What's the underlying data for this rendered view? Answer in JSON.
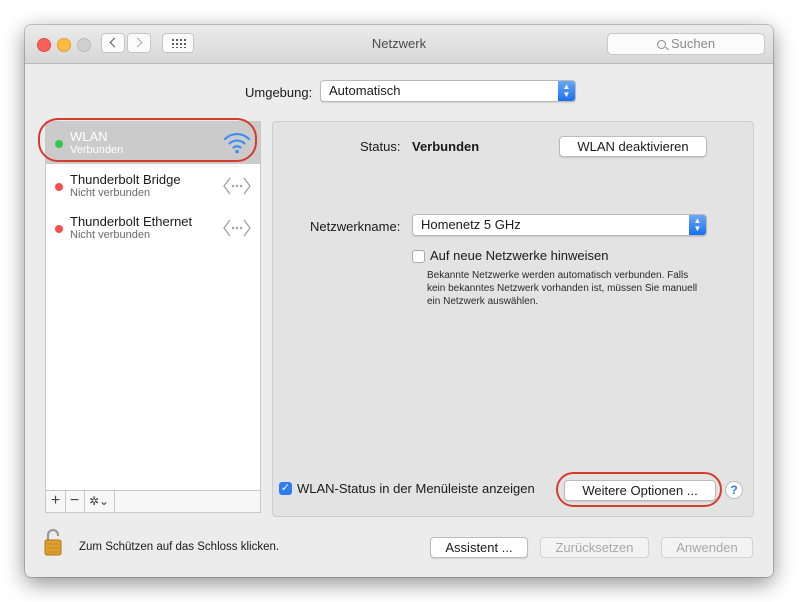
{
  "window": {
    "title": "Netzwerk"
  },
  "toolbar": {
    "search_placeholder": "Suchen"
  },
  "location": {
    "label": "Umgebung:",
    "value": "Automatisch"
  },
  "services": [
    {
      "name": "WLAN",
      "status": "Verbunden",
      "indicator": "#34c84a",
      "icon": "wifi-icon",
      "selected": true
    },
    {
      "name": "Thunderbolt Bridge",
      "status": "Nicht verbunden",
      "indicator": "#fc4c4c",
      "icon": "ethernet-arrows-icon"
    },
    {
      "name": "Thunderbolt Ethernet",
      "status": "Nicht verbunden",
      "indicator": "#fc4c4c",
      "icon": "ethernet-arrows-icon"
    }
  ],
  "sidebar_toolbar": {
    "add": "+",
    "remove": "−",
    "gear": "✲⌄"
  },
  "detail": {
    "status_label": "Status:",
    "status_value": "Verbunden",
    "toggle_button": "WLAN deaktivieren",
    "network_label": "Netzwerkname:",
    "network_value": "Homenetz 5 GHz",
    "ask_checkbox_label": "Auf neue Netzwerke hinweisen",
    "ask_checked": false,
    "help_text": "Bekannte Netzwerke werden automatisch verbunden. Falls kein bekanntes Netzwerk vorhanden ist, müssen Sie manuell ein Netzwerk auswählen.",
    "menubar_checkbox_label": "WLAN-Status in der Menüleiste anzeigen",
    "menubar_checked": true,
    "advanced_button": "Weitere Optionen ...",
    "help_button": "?"
  },
  "footer": {
    "lock_label": "Zum Schützen auf das Schloss klicken.",
    "assistant": "Assistent ...",
    "revert": "Zurücksetzen",
    "apply": "Anwenden"
  },
  "colors": {
    "accent": "#2f7cf6",
    "highlight_ring": "#d63b2f",
    "wifi": "#3b8ef0"
  }
}
